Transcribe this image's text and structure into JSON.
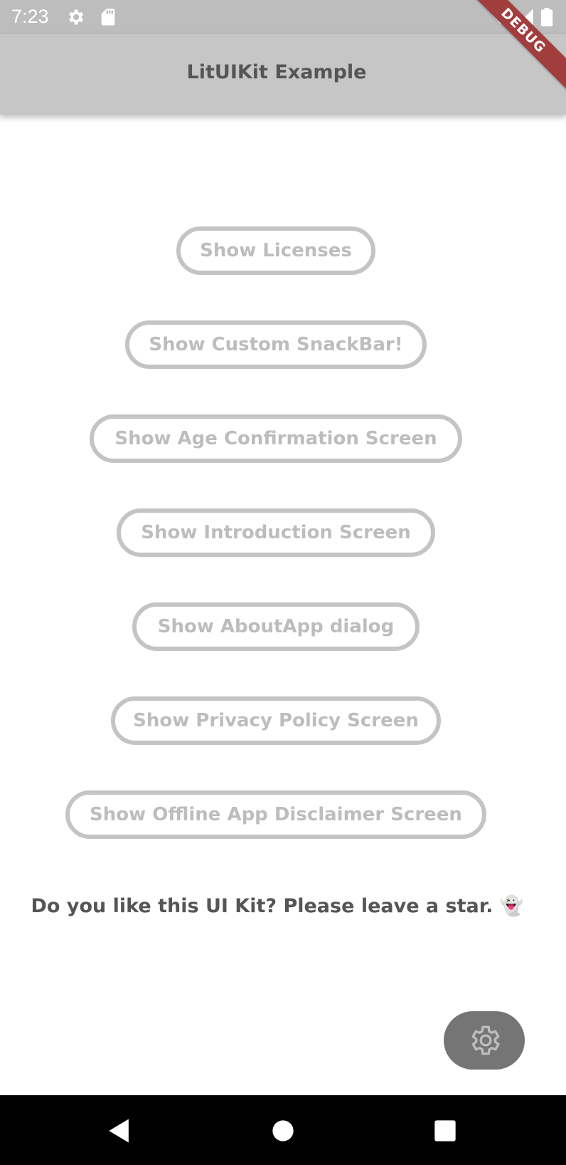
{
  "status_bar": {
    "time": "7:23",
    "icons": [
      "gear-icon",
      "sd-card-icon",
      "wifi-icon",
      "signal-icon",
      "battery-icon"
    ]
  },
  "app_bar": {
    "title": "LitUIKit Example",
    "debug_label": "DEBUG"
  },
  "buttons": [
    {
      "label": "Show Licenses"
    },
    {
      "label": "Show Custom SnackBar!"
    },
    {
      "label": "Show Age Confirmation Screen"
    },
    {
      "label": "Show Introduction Screen"
    },
    {
      "label": "Show AboutApp dialog"
    },
    {
      "label": "Show Privacy Policy Screen"
    },
    {
      "label": "Show Offline App Disclaimer Screen"
    }
  ],
  "footer": {
    "text": "Do you like this UI Kit? Please leave a star. 👻"
  },
  "fab": {
    "icon": "gear-icon"
  },
  "nav_bar": {
    "icons": [
      "back-icon",
      "home-icon",
      "recents-icon"
    ]
  },
  "colors": {
    "status_bar": "#bdbdbd",
    "app_bar": "#c6c6c6",
    "button_border": "#c4c4c4",
    "button_text": "#bdbdbd",
    "title_text": "#555555",
    "fab": "#757575",
    "debug_ribbon": "#a23d3d"
  }
}
